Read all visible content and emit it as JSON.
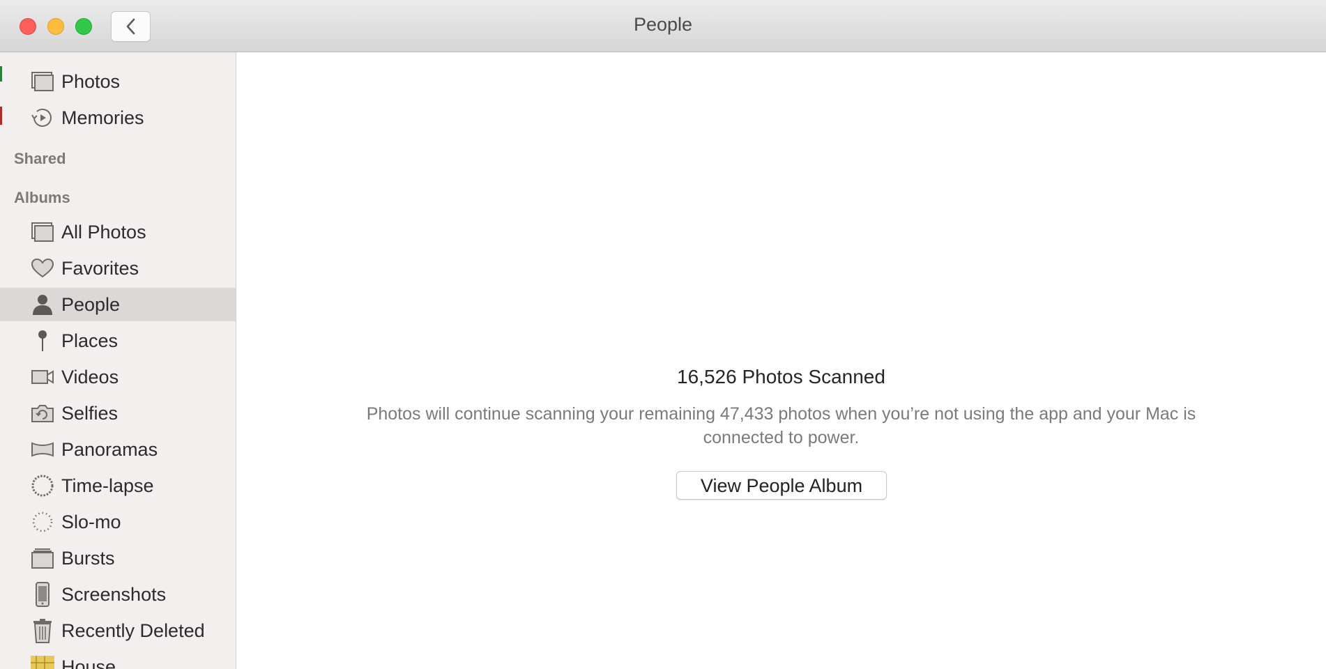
{
  "window": {
    "title": "People"
  },
  "sidebar": {
    "top_items": [
      {
        "label": "Photos",
        "icon": "photos-icon"
      },
      {
        "label": "Memories",
        "icon": "memories-icon"
      }
    ],
    "shared_header": "Shared",
    "albums_header": "Albums",
    "albums": [
      {
        "label": "All Photos",
        "icon": "all-photos-icon"
      },
      {
        "label": "Favorites",
        "icon": "heart-icon"
      },
      {
        "label": "People",
        "icon": "person-icon",
        "selected": true
      },
      {
        "label": "Places",
        "icon": "pin-icon"
      },
      {
        "label": "Videos",
        "icon": "video-camera-icon"
      },
      {
        "label": "Selfies",
        "icon": "selfie-camera-icon"
      },
      {
        "label": "Panoramas",
        "icon": "panorama-icon"
      },
      {
        "label": "Time-lapse",
        "icon": "timelapse-icon"
      },
      {
        "label": "Slo-mo",
        "icon": "slomo-icon"
      },
      {
        "label": "Bursts",
        "icon": "bursts-icon"
      },
      {
        "label": "Screenshots",
        "icon": "phone-icon"
      },
      {
        "label": "Recently Deleted",
        "icon": "trash-icon"
      },
      {
        "label": "House",
        "icon": "album-thumbnail-icon"
      }
    ]
  },
  "main": {
    "scan_title": "16,526 Photos Scanned",
    "scan_description": "Photos will continue scanning your remaining 47,433 photos when you’re not using the app and your Mac is connected to power.",
    "view_button_label": "View People Album"
  },
  "colors": {
    "close": "#fc605c",
    "minimize": "#fdbc40",
    "maximize": "#34c84a",
    "sidebar_bg": "#f2efee",
    "sidebar_selected": "#dcd8d7"
  }
}
